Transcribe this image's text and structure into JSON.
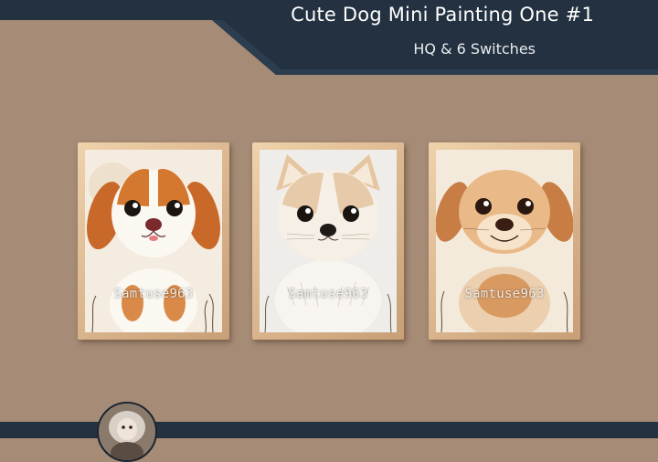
{
  "banner": {
    "title": "Cute Dog Mini Painting One #1",
    "subtitle": "HQ & 6 Switches"
  },
  "colors": {
    "background": "#a68b76",
    "banner": "#233140",
    "frame": "#d9b48c"
  },
  "paintings": [
    {
      "subject": "brown-white-puppy",
      "watermark": "Samtuse963"
    },
    {
      "subject": "fluffy-cream-puppy",
      "watermark": "Samtuse963"
    },
    {
      "subject": "golden-puppy",
      "watermark": "Samtuse963"
    }
  ]
}
